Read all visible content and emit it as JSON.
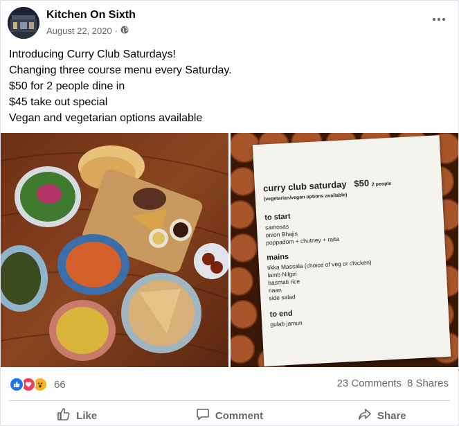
{
  "post": {
    "page_name": "Kitchen On Sixth",
    "date": "August 22, 2020",
    "separator": "·",
    "privacy_icon": "globe-icon",
    "more_icon": "more-options-icon",
    "text_lines": [
      "Introducing Curry Club Saturdays!",
      "Changing three course menu every Saturday.",
      "$50 for 2 people dine in",
      "$45 take out special",
      "Vegan and vegetarian options available"
    ]
  },
  "menu_photo": {
    "title": "curry club saturday",
    "price": "$50",
    "price_note": "2 people",
    "subtitle": "(vegetarian/vegan options available)",
    "sections": [
      {
        "heading": "to start",
        "items": [
          "samosas",
          "onion Bhajis",
          "poppadom + chutney + raita"
        ]
      },
      {
        "heading": "mains",
        "items": [
          "tikka Massala (choice of veg or chicken)",
          "lamb Nilgiri",
          "basmati rice",
          "naan",
          "side salad"
        ]
      },
      {
        "heading": "to end",
        "items": [
          "gulab jamun"
        ]
      }
    ]
  },
  "stats": {
    "reaction_count": "66",
    "comments": "23 Comments",
    "shares": "8 Shares",
    "reaction_icons": [
      "like-icon",
      "love-icon",
      "wow-icon"
    ]
  },
  "actions": {
    "like": "Like",
    "comment": "Comment",
    "share": "Share"
  },
  "colors": {
    "like_blue": "#1877f2",
    "love_red": "#f33e58",
    "wow_yellow": "#f7b125",
    "muted_text": "#65676b"
  }
}
